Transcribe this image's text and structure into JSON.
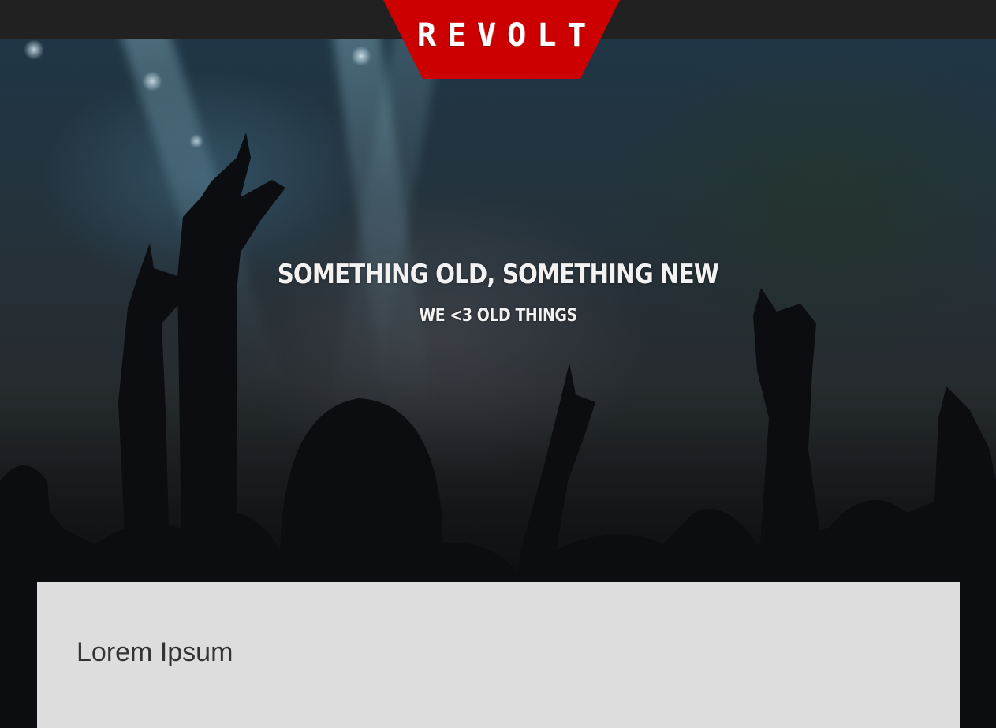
{
  "header": {
    "logo_text": "REVOLT",
    "logo_color": "#cc0000",
    "bar_color": "#212121"
  },
  "hero": {
    "title": "Something old, something new",
    "subtitle": "We <3 old things"
  },
  "content": {
    "heading": "Lorem Ipsum",
    "card_color": "#dddddd"
  }
}
